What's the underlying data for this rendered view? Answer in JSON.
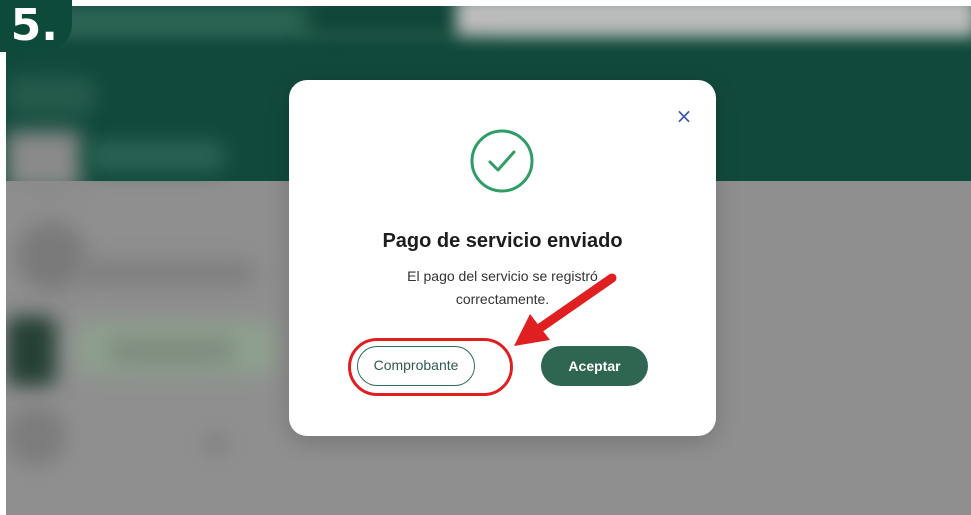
{
  "step_badge": {
    "label": "5."
  },
  "modal": {
    "title": "Pago de servicio enviado",
    "message_line1": "El pago del servicio se registró",
    "message_line2": "correctamente.",
    "close_icon": "×",
    "receipt_button": "Comprobante",
    "accept_button": "Aceptar"
  },
  "icons": {
    "success": "check-circle-icon",
    "close": "close-icon",
    "annotation": "red-arrow-icon"
  },
  "colors": {
    "brand_green": "#114a3b",
    "button_green": "#2f6652",
    "success_green": "#2e9e66",
    "annotation_red": "#e02020",
    "close_blue": "#3b5aa3"
  }
}
